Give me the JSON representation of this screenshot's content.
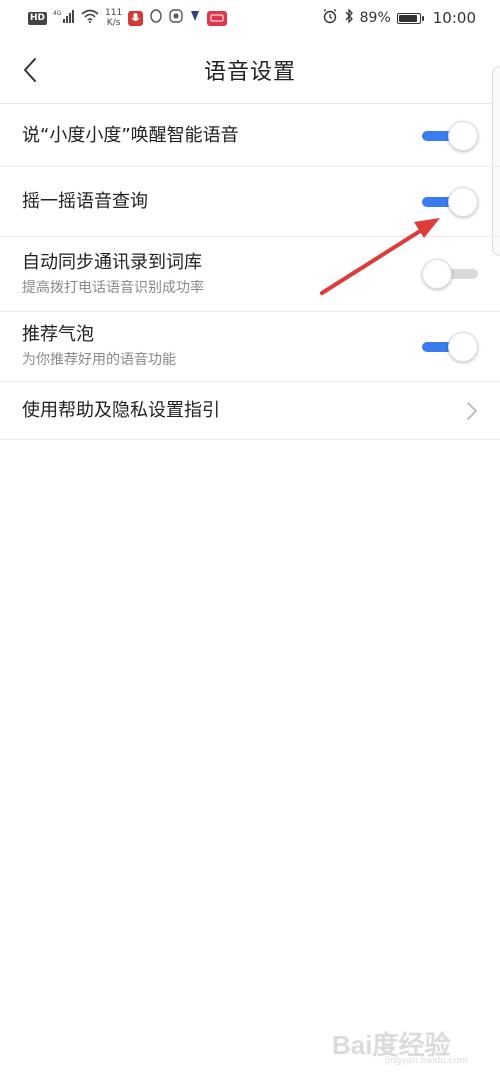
{
  "status_bar": {
    "hd": "HD",
    "network": "4G",
    "speed_value": "111",
    "speed_unit": "K/s",
    "battery": "89%",
    "battery_level": 0.89,
    "time": "10:00"
  },
  "header": {
    "title": "语音设置",
    "back_icon": "chevron-left-icon"
  },
  "settings": [
    {
      "title": "说“小度小度”唤醒智能语音",
      "subtitle": "",
      "state": "on"
    },
    {
      "title": "摇一摇语音查询",
      "subtitle": "",
      "state": "on"
    },
    {
      "title": "自动同步通讯录到词库",
      "subtitle": "提高拨打电话语音识别成功率",
      "state": "off"
    },
    {
      "title": "推荐气泡",
      "subtitle": "为你推荐好用的语音功能",
      "state": "on"
    },
    {
      "title": "使用帮助及隐私设置指引",
      "subtitle": "",
      "state": "link"
    }
  ],
  "colors": {
    "toggle_on": "#3a7cf0",
    "toggle_off": "#d9d9d9",
    "annotation_arrow": "#e03a3a"
  },
  "watermark": {
    "text": "Bai度经验",
    "sub": "jingyan.baidu.com"
  }
}
